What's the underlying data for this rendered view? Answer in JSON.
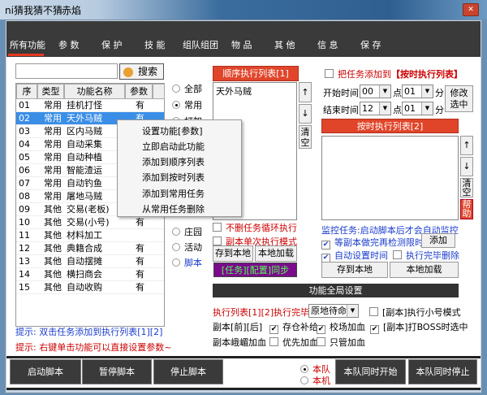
{
  "window": {
    "title": "ni猜我猜不猜",
    "subtitle": "赤焰",
    "close_icon": "close-icon"
  },
  "tabs": [
    "所有功能",
    "参 数",
    "保 护",
    "技 能",
    "组队组团",
    "物 品",
    "其 他",
    "信 息",
    "保 存"
  ],
  "search": {
    "value": "",
    "button": "搜索"
  },
  "table": {
    "headers": [
      "序",
      "类型",
      "功能名称",
      "参数"
    ],
    "rows": [
      [
        "01",
        "常用",
        "挂机打怪",
        "有"
      ],
      [
        "02",
        "常用",
        "天外马贼",
        "有"
      ],
      [
        "03",
        "常用",
        "区内马贼",
        ""
      ],
      [
        "04",
        "常用",
        "自动采集",
        ""
      ],
      [
        "05",
        "常用",
        "自动种植",
        ""
      ],
      [
        "06",
        "常用",
        "智能渣运",
        ""
      ],
      [
        "07",
        "常用",
        "自动钓鱼",
        ""
      ],
      [
        "08",
        "常用",
        "屠地马贼",
        ""
      ],
      [
        "09",
        "其他",
        "交易(老板)",
        ""
      ],
      [
        "10",
        "其他",
        "交易(小号)",
        "有"
      ],
      [
        "11",
        "其他",
        "材料加工",
        ""
      ],
      [
        "12",
        "其他",
        "典籍合成",
        "有"
      ],
      [
        "13",
        "其他",
        "自动摆摊",
        "有"
      ],
      [
        "14",
        "其他",
        "横扫商会",
        "有"
      ],
      [
        "15",
        "其他",
        "自动收购",
        "有"
      ]
    ]
  },
  "filters": [
    "全部",
    "常用",
    "打架",
    "庄园",
    "活动",
    "脚本"
  ],
  "context_menu": [
    "设置功能[参数]",
    "立即启动此功能",
    "添加到顺序列表",
    "添加到按时列表",
    "添加到常用任务",
    "从常用任务删除"
  ],
  "seq": {
    "header": "顺序执行列表[1]",
    "items": [
      "天外马贼"
    ],
    "up": "↑",
    "down": "↓",
    "clear": "清空",
    "loop": "不删任务循环执行",
    "single": "副本单次执行模式",
    "save": "存到本地",
    "load": "本地加载",
    "sync": "[任务][配置]同步"
  },
  "timed": {
    "add_check": "把任务添加到",
    "add_target": "【按时执行列表】",
    "start_label": "开始时间",
    "end_label": "结束时间",
    "start_h": "00",
    "start_m": "01",
    "end_h": "12",
    "end_m": "01",
    "hour": "点",
    "minute": "分",
    "modify": "修改选中",
    "header": "按时执行列表[2]",
    "up": "↑",
    "down": "↓",
    "clear": "清空",
    "help": "帮助",
    "monitor": "监控任务:启动脚本后才会自动监控",
    "wait": "等副本做完再检测限时",
    "add": "添加",
    "auto": "自动设置时间",
    "del": "执行完毕删除",
    "save": "存到本地",
    "load": "本地加载"
  },
  "global": {
    "header": "功能全局设置",
    "finish_label": "执行列表[1][2]执行完毕",
    "finish_value": "原地待命",
    "small": "[副本]执行小号模式",
    "pre": "副本[前][后]",
    "store": "存仓补给",
    "camp": "校场加血",
    "boss": "[副本]打BOSS时选中",
    "emei": "副本峨嵋加血",
    "prio": "优先加血",
    "only": "只管加血"
  },
  "tips": {
    "blue": "提示: 双击任务添加到执行列表[1][2]",
    "red": "提示: 右键单击功能可以直接设置参数~"
  },
  "bottom": {
    "start": "启动脚本",
    "pause": "暂停脚本",
    "stop": "停止脚本",
    "team": "本队",
    "local": "本机",
    "team_start": "本队同时开始",
    "team_stop": "本队同时停止"
  }
}
